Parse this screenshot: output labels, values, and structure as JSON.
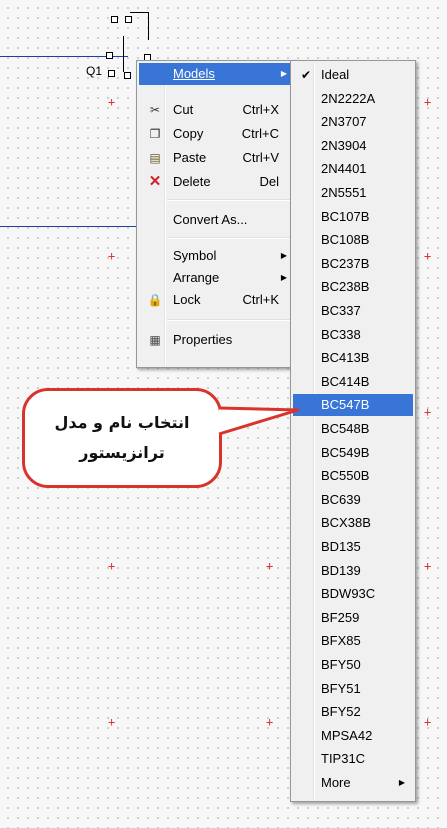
{
  "canvas": {
    "component_label": "Q1"
  },
  "context_menu": {
    "items": [
      {
        "label": "Models",
        "shortcut": "",
        "icon": "",
        "submenu": true,
        "highlighted": true
      },
      {
        "label": "Cut",
        "shortcut": "Ctrl+X",
        "icon": "scissors-icon"
      },
      {
        "label": "Copy",
        "shortcut": "Ctrl+C",
        "icon": "copy-icon"
      },
      {
        "label": "Paste",
        "shortcut": "Ctrl+V",
        "icon": "paste-icon"
      },
      {
        "label": "Delete",
        "shortcut": "Del",
        "icon": "delete-icon"
      },
      {
        "label": "Convert As...",
        "shortcut": "",
        "icon": ""
      },
      {
        "label": "Symbol",
        "shortcut": "",
        "icon": "",
        "submenu": true
      },
      {
        "label": "Arrange",
        "shortcut": "",
        "icon": "",
        "submenu": true
      },
      {
        "label": "Lock",
        "shortcut": "Ctrl+K",
        "icon": "lock-icon"
      },
      {
        "label": "Properties",
        "shortcut": "",
        "icon": "properties-icon"
      }
    ]
  },
  "models_submenu": {
    "selected": "Ideal",
    "highlighted": "BC547B",
    "items": [
      "Ideal",
      "2N2222A",
      "2N3707",
      "2N3904",
      "2N4401",
      "2N5551",
      "BC107B",
      "BC108B",
      "BC237B",
      "BC238B",
      "BC337",
      "BC338",
      "BC413B",
      "BC414B",
      "BC547B",
      "BC548B",
      "BC549B",
      "BC550B",
      "BC639",
      "BCX38B",
      "BD135",
      "BD139",
      "BDW93C",
      "BF259",
      "BFX85",
      "BFY50",
      "BFY51",
      "BFY52",
      "MPSA42",
      "TIP31C",
      "More"
    ]
  },
  "callout": {
    "line1": "انتخاب نام و مدل",
    "line2": "ترانزیستور",
    "border_color": "#d9342b"
  },
  "colors": {
    "highlight": "#3875d7",
    "wire": "#1f3fa8",
    "grid_marker": "#e53030"
  }
}
